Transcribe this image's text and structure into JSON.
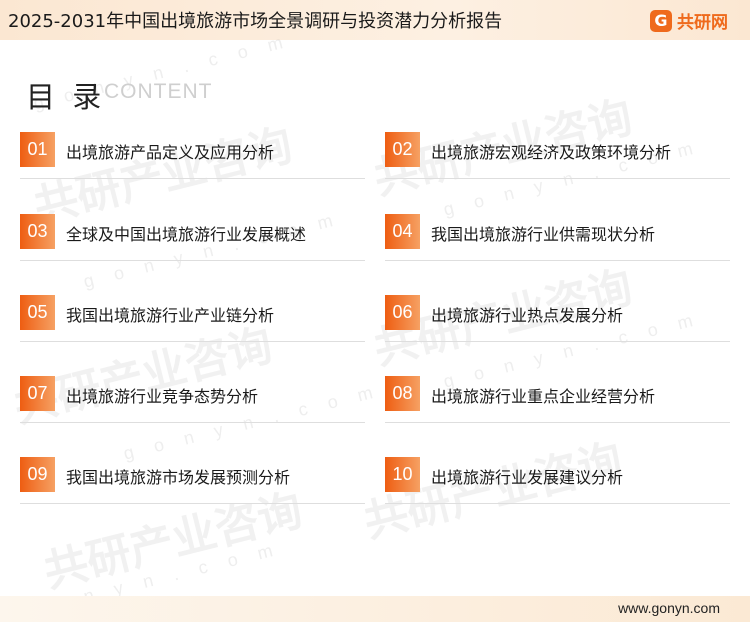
{
  "header": {
    "title": "2025-2031年中国出境旅游市场全景调研与投资潜力分析报告",
    "brand_icon": "G",
    "brand_name": "共研网",
    "brand_color": "#ef6a1c"
  },
  "toc": {
    "title": "目 录",
    "subtitle": "CONTENT"
  },
  "items": [
    {
      "num": "01",
      "label": "出境旅游产品定义及应用分析"
    },
    {
      "num": "02",
      "label": "出境旅游宏观经济及政策环境分析"
    },
    {
      "num": "03",
      "label": "全球及中国出境旅游行业发展概述"
    },
    {
      "num": "04",
      "label": "我国出境旅游行业供需现状分析"
    },
    {
      "num": "05",
      "label": "我国出境旅游行业产业链分析"
    },
    {
      "num": "06",
      "label": "出境旅游行业热点发展分析"
    },
    {
      "num": "07",
      "label": "出境旅游行业竞争态势分析"
    },
    {
      "num": "08",
      "label": "出境旅游行业重点企业经营分析"
    },
    {
      "num": "09",
      "label": "我国出境旅游市场发展预测分析"
    },
    {
      "num": "10",
      "label": "出境旅游行业发展建议分析"
    }
  ],
  "watermark": {
    "text": "共研产业咨询",
    "url": "g o n y n . c o m"
  },
  "footer": {
    "url": "www.gonyn.com"
  },
  "colors": {
    "accent": "#ee5d12",
    "header_bg": "#fbe7d2"
  }
}
